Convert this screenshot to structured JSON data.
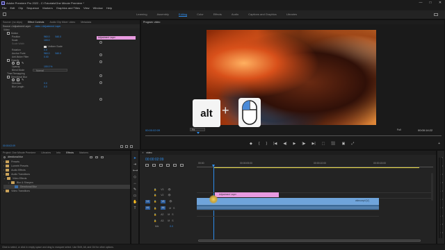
{
  "window": {
    "title": "Adobe Premiere Pro 2022 - C:\\Tutorials\\One Minute Premiere *",
    "controls": [
      "—",
      "□",
      "✕"
    ]
  },
  "menu": [
    "File",
    "Edit",
    "Clip",
    "Sequence",
    "Markers",
    "Graphics and Titles",
    "View",
    "Window",
    "Help"
  ],
  "workspaces": {
    "tabs": [
      "Learning",
      "Assembly",
      "Editing",
      "Color",
      "Effects",
      "Audio",
      "Captions and Graphics",
      "Libraries"
    ],
    "active": "Editing"
  },
  "source_panel": {
    "tabs": [
      "Source: (no clips)",
      "Effect Controls",
      "Audio Clip Mixer: video",
      "Metadata"
    ],
    "active_tab": "Effect Controls",
    "clip_header": "Source • Adjustment Layer",
    "sequence_header": "video • Adjustment Layer",
    "clip_chip": "Adjustment Layer",
    "section": "Video",
    "rows": [
      {
        "label": "Motion",
        "value": "",
        "indent": 0
      },
      {
        "label": "Position",
        "value": "960.0",
        "value2": "540.0",
        "indent": 1
      },
      {
        "label": "Scale",
        "value": "100.0",
        "indent": 1
      },
      {
        "label": "Scale Width",
        "value": "",
        "indent": 1
      },
      {
        "label": "Uniform Scale",
        "value": "",
        "indent": 1,
        "checkbox": true
      },
      {
        "label": "Rotation",
        "value": "0.0",
        "indent": 1
      },
      {
        "label": "Anchor Point",
        "value": "960.0",
        "value2": "540.0",
        "indent": 1
      },
      {
        "label": "Anti-flicker Filter",
        "value": "0.00",
        "indent": 1
      },
      {
        "label": "Opacity",
        "value": "",
        "indent": 0
      },
      {
        "label": "Opacity",
        "value": "100.0 %",
        "indent": 1
      },
      {
        "label": "Blend Mode",
        "value": "Normal",
        "indent": 1
      },
      {
        "label": "Time Remapping",
        "value": "",
        "indent": 0
      },
      {
        "label": "Directional Blur",
        "value": "",
        "indent": 0
      },
      {
        "label": "Direction",
        "value": "0.0",
        "indent": 1
      },
      {
        "label": "Blur Length",
        "value": "0.0",
        "indent": 1
      }
    ],
    "timecode": "00:00:02:09"
  },
  "program": {
    "title": "Program: video",
    "timecode_left": "00:00:02:09",
    "fit": "Fit",
    "quality": "Full",
    "timecode_right": "00:00:14:22",
    "overlay_key": "alt",
    "overlay_plus": "+"
  },
  "transport": [
    "◆",
    "{",
    "}",
    "|◀",
    "◀|",
    "▶",
    "|▶",
    "▶|",
    "⬚",
    "⬛",
    "▣",
    "⤢",
    "+"
  ],
  "project_panel": {
    "tabs": [
      "Project: One Minute Premiere",
      "Libraries",
      "Info",
      "Effects",
      "Markers"
    ],
    "active_tab": "Effects",
    "search_value": "directional blur",
    "items": [
      {
        "label": "Presets",
        "type": "folder",
        "indent": 0
      },
      {
        "label": "Lumetri Presets",
        "type": "folder",
        "indent": 0
      },
      {
        "label": "Audio Effects",
        "type": "folder",
        "indent": 0
      },
      {
        "label": "Audio Transitions",
        "type": "folder",
        "indent": 0
      },
      {
        "label": "Video Effects",
        "type": "folder",
        "indent": 0
      },
      {
        "label": "Blur & Sharpen",
        "type": "folder",
        "indent": 1
      },
      {
        "label": "Directional Blur",
        "type": "effect",
        "indent": 2
      },
      {
        "label": "Video Transitions",
        "type": "folder",
        "indent": 0
      }
    ]
  },
  "timeline": {
    "tab": "video",
    "timecode": "00:00:02:09",
    "ruler": [
      "00:00",
      "00:00:05:00",
      "00:00:10:00",
      "00:00:15:00"
    ],
    "tracks": [
      {
        "name": "V3",
        "type": "video"
      },
      {
        "name": "V2",
        "type": "video"
      },
      {
        "name": "V1",
        "type": "video",
        "target": "V1"
      },
      {
        "name": "A1",
        "type": "audio",
        "target": "A1"
      },
      {
        "name": "A2",
        "type": "audio"
      },
      {
        "name": "A3",
        "type": "audio"
      }
    ],
    "mix_label": "Mix",
    "mix_value": "0.0",
    "clips": {
      "adjustment": "Adjustment Layer",
      "video": "video.mp4 [V]"
    }
  },
  "meters": [
    "0",
    "-6",
    "-12",
    "-18",
    "-24",
    "-30",
    "-36",
    "-42",
    "-48",
    "-54"
  ],
  "status": "Click to select, or click in empty space and drag to marquee select. Use Shift, Alt, and Ctrl for other options.",
  "colors": {
    "accent": "#2d8ceb",
    "adjustment_clip": "#e89ae0",
    "video_clip": "#6fa4db",
    "audio_clip": "#3c6a98"
  }
}
